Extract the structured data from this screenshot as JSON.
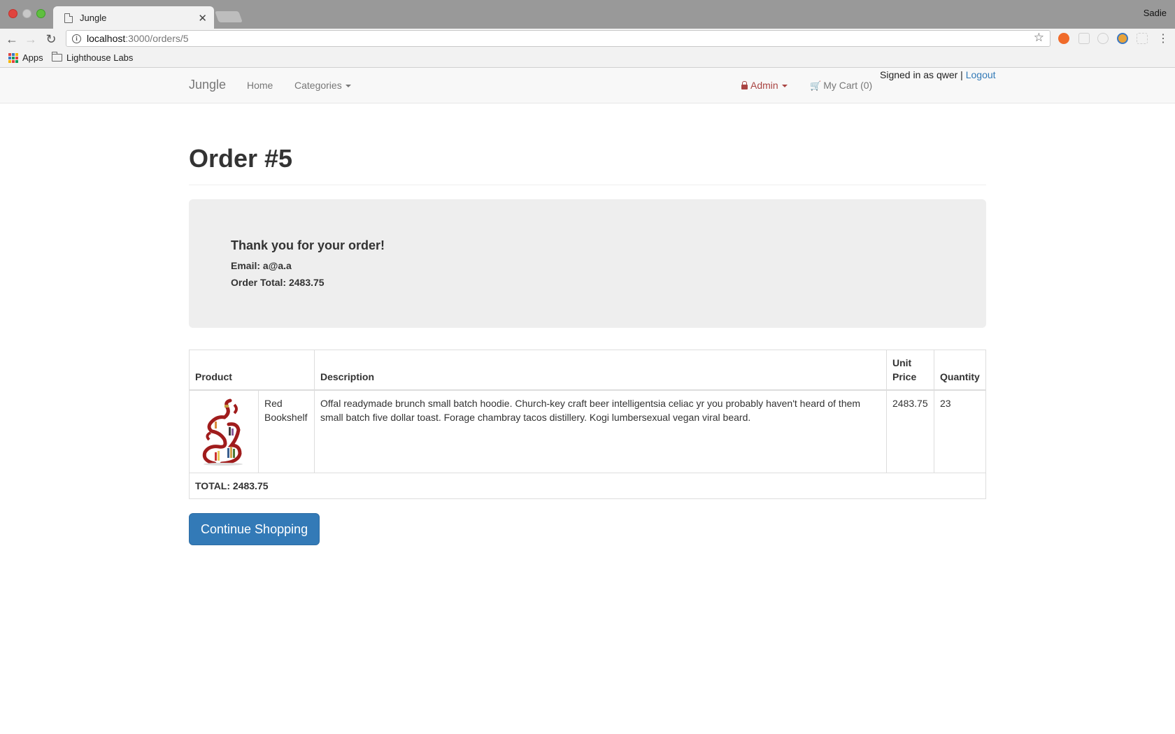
{
  "browser": {
    "tab_title": "Jungle",
    "tab_close": "✕",
    "profile_name": "Sadie",
    "url_host": "localhost",
    "url_path": ":3000/orders/5",
    "bookmarks": [
      {
        "label": "Apps"
      },
      {
        "label": "Lighthouse Labs"
      }
    ]
  },
  "navbar": {
    "brand": "Jungle",
    "home": "Home",
    "categories": "Categories",
    "admin": "Admin",
    "cart": "My Cart (0)",
    "signed_in": "Signed in as qwer | ",
    "logout": "Logout",
    "admin_color": "#a94442",
    "link_color": "#337ab7"
  },
  "order": {
    "title": "Order #5",
    "thank_you": "Thank you for your order!",
    "email_line": "Email: a@a.a",
    "total_line": "Order Total: 2483.75"
  },
  "table": {
    "headers": {
      "product": "Product",
      "description": "Description",
      "unit_price": "Unit Price",
      "quantity": "Quantity"
    },
    "rows": [
      {
        "name": "Red Bookshelf",
        "description": "Offal readymade brunch small batch hoodie. Church-key craft beer intelligentsia celiac yr you probably haven't heard of them small batch five dollar toast. Forage chambray tacos distillery. Kogi lumbersexual vegan viral beard.",
        "unit_price": "2483.75",
        "quantity": "23"
      }
    ],
    "total": "TOTAL: 2483.75"
  },
  "actions": {
    "continue_shopping": "Continue Shopping",
    "button_color": "#337ab7"
  }
}
